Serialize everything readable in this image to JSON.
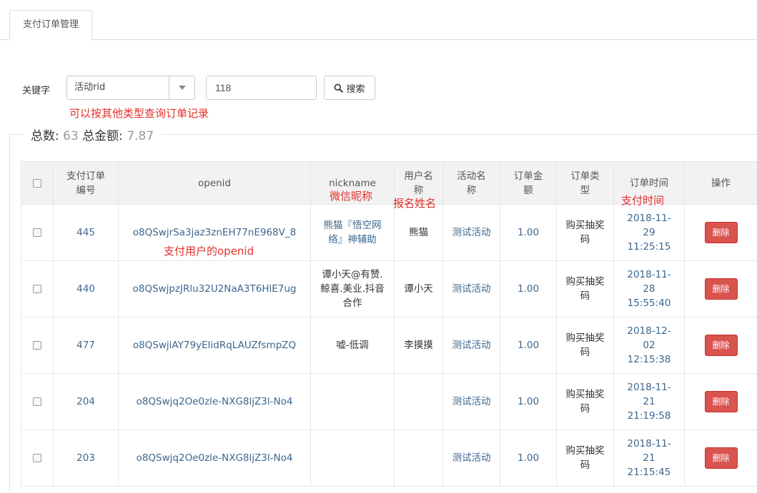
{
  "tab": {
    "label": "支付订单管理"
  },
  "search": {
    "label": "关键字",
    "type_value": "活动rid",
    "keyword_value": "118",
    "button_label": "搜索"
  },
  "annotations": {
    "search_hint": "可以按其他类型查询订单记录",
    "nickname_hint": "微信昵称",
    "username_hint": "报名姓名",
    "time_hint": "支付时间",
    "openid_hint": "支付用户的openid"
  },
  "summary": {
    "total_label": "总数:",
    "total_value": "63",
    "amount_label": "总金额:",
    "amount_value": "7.87"
  },
  "table": {
    "headers": {
      "order_no": "支付订单编号",
      "openid": "openid",
      "nickname": "nickname",
      "username": "用户名称",
      "activity": "活动名称",
      "amount": "订单金额",
      "type": "订单类型",
      "time": "订单时间",
      "action": "操作"
    },
    "delete_label": "删除",
    "rows": [
      {
        "order_no": "445",
        "openid": "o8QSwjrSa3jaz3znEH77nE968V_8",
        "nickname": "熊猫『悟空网络』神辅助",
        "username": "熊猫",
        "activity": "测试活动",
        "amount": "1.00",
        "type": "购买抽奖码",
        "time": "2018-11-29 11:25:15"
      },
      {
        "order_no": "440",
        "openid": "o8QSwjpzJRlu32U2NaA3T6HlE7ug",
        "nickname": "谭小天@有赞.鲸喜.美业.抖音合作",
        "username": "谭小天",
        "activity": "测试活动",
        "amount": "1.00",
        "type": "购买抽奖码",
        "time": "2018-11-28 15:55:40"
      },
      {
        "order_no": "477",
        "openid": "o8QSwjiAY79yEIidRqLAUZfsmpZQ",
        "nickname": "嘘-低调",
        "username": "李摸摸",
        "activity": "测试活动",
        "amount": "1.00",
        "type": "购买抽奖码",
        "time": "2018-12-02 12:15:38"
      },
      {
        "order_no": "204",
        "openid": "o8QSwjq2Oe0zle-NXG8ljZ3l-No4",
        "nickname": "",
        "username": "",
        "activity": "测试活动",
        "amount": "1.00",
        "type": "购买抽奖码",
        "time": "2018-11-21 21:19:58"
      },
      {
        "order_no": "203",
        "openid": "o8QSwjq2Oe0zle-NXG8ljZ3l-No4",
        "nickname": "",
        "username": "",
        "activity": "测试活动",
        "amount": "1.00",
        "type": "购买抽奖码",
        "time": "2018-11-21 21:15:45"
      }
    ]
  }
}
